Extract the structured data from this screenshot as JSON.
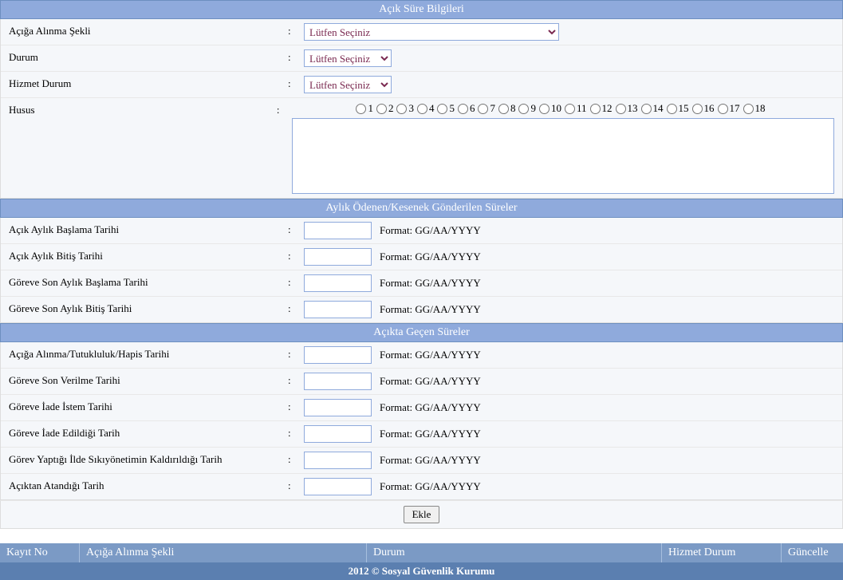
{
  "sections": {
    "sureBilgileri": "Açık Süre Bilgileri",
    "aylikOdenen": "Aylık Ödenen/Kesenek Gönderilen Süreler",
    "aciktaGecen": "Açıkta Geçen Süreler"
  },
  "formatHint": "Format: GG/AA/YYYY",
  "selectPlaceholder": "Lütfen Seçiniz",
  "labels": {
    "acigaAlinmaSekli": "Açığa Alınma Şekli",
    "durum": "Durum",
    "hizmetDurum": "Hizmet Durum",
    "husus": "Husus",
    "acikAylikBaslama": "Açık Aylık Başlama Tarihi",
    "acikAylikBitis": "Açık Aylık Bitiş Tarihi",
    "goreveSonAylikBaslama": "Göreve Son Aylık Başlama Tarihi",
    "goreveSonAylikBitis": "Göreve Son Aylık Bitiş Tarihi",
    "acigaAlinmaTutuklulukHapis": "Açığa Alınma/Tutukluluk/Hapis Tarihi",
    "goreveSonVerilme": "Göreve Son Verilme Tarihi",
    "goreveIadeIstem": "Göreve İade İstem Tarihi",
    "goreveIadeEdildigi": "Göreve İade Edildiği Tarih",
    "sikiyonetim": "Görev Yaptığı İlde Sıkıyönetimin Kaldırıldığı Tarih",
    "aciktanAtandigi": "Açıktan Atandığı Tarih"
  },
  "hususOptions": [
    "1",
    "2",
    "3",
    "4",
    "5",
    "6",
    "7",
    "8",
    "9",
    "10",
    "11",
    "12",
    "13",
    "14",
    "15",
    "16",
    "17",
    "18"
  ],
  "ekleButton": "Ekle",
  "tableHeaders": {
    "kayitNo": "Kayıt No",
    "acigaAlinmaSekli": "Açığa Alınma Şekli",
    "durum": "Durum",
    "hizmetDurum": "Hizmet Durum",
    "guncelle": "Güncelle"
  },
  "footer": "2012 © Sosyal Güvenlik Kurumu"
}
